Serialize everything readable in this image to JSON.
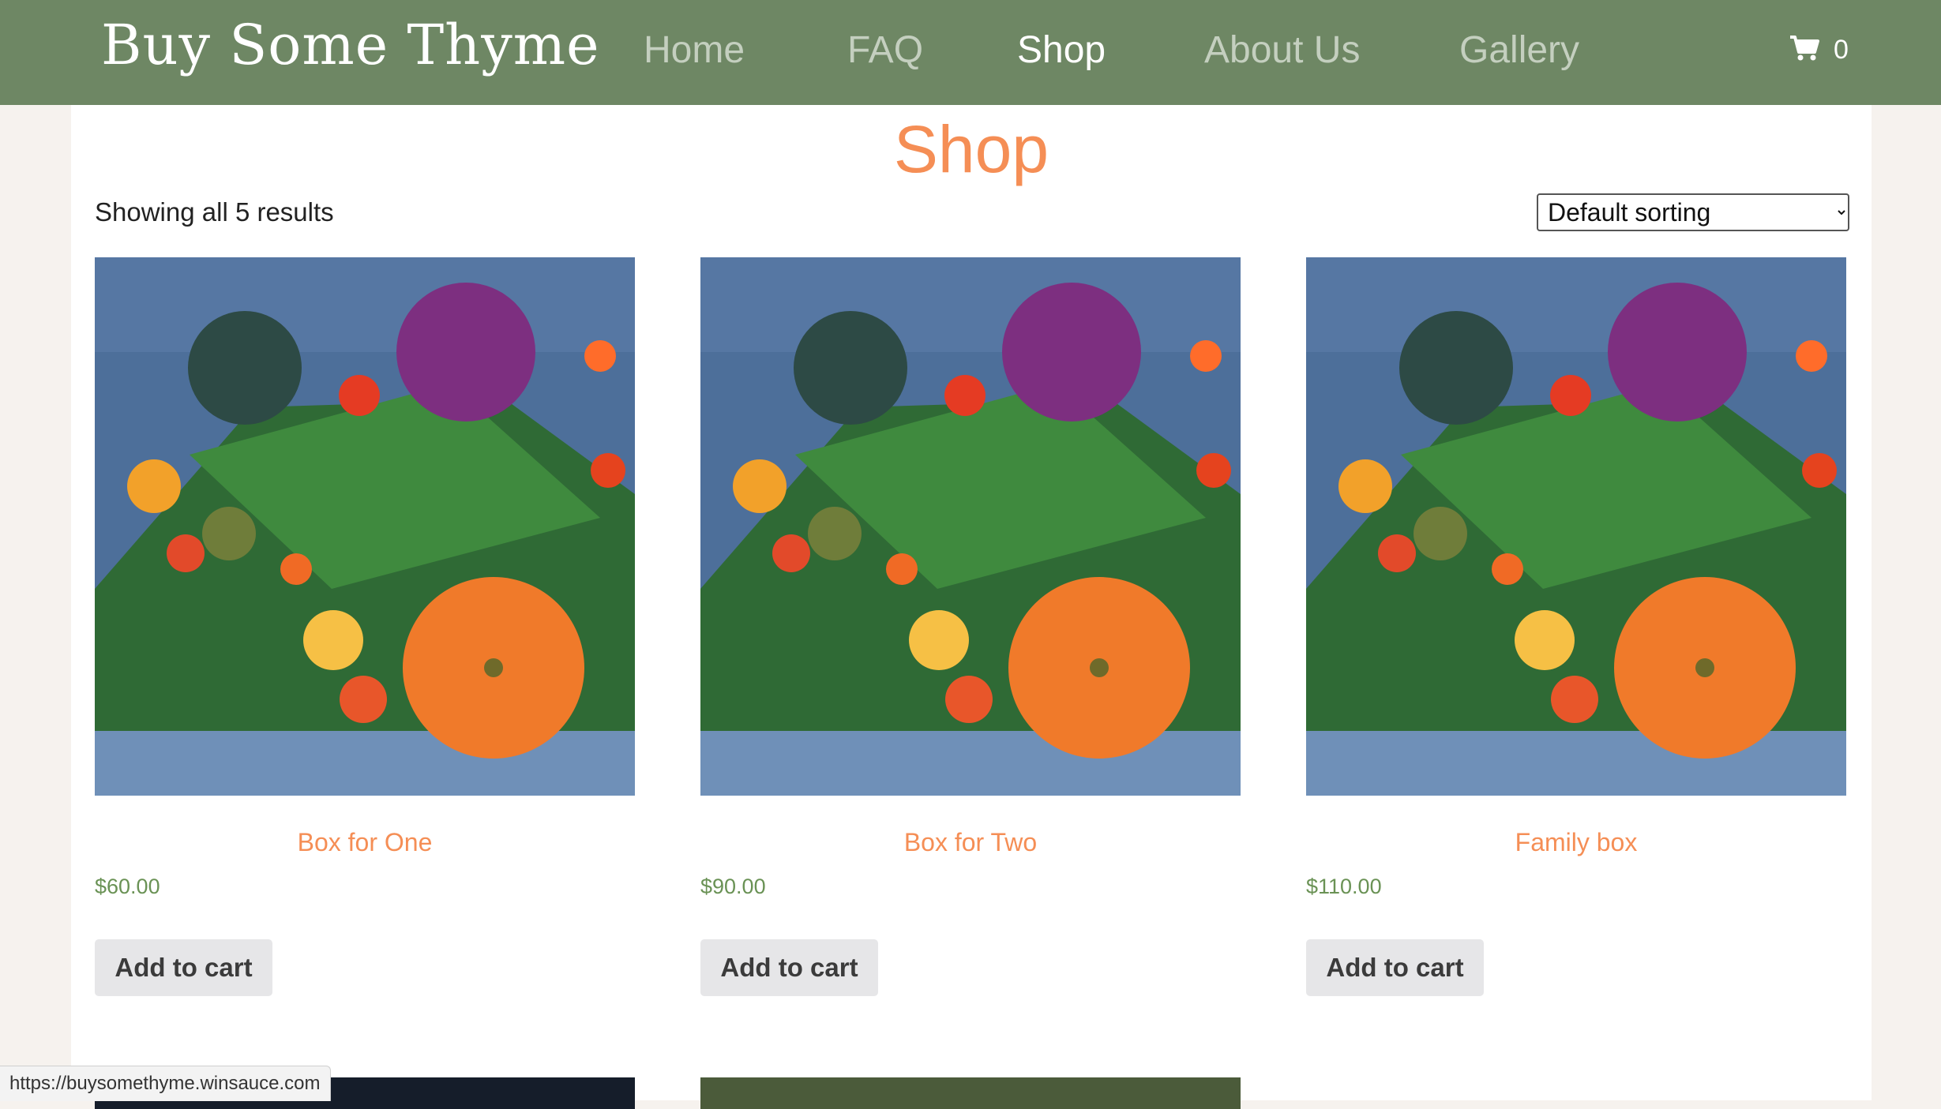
{
  "header": {
    "brand": "Buy Some Thyme",
    "nav": [
      {
        "label": "Home",
        "active": false
      },
      {
        "label": "FAQ",
        "active": false
      },
      {
        "label": "Shop",
        "active": true
      },
      {
        "label": "About Us",
        "active": false
      },
      {
        "label": "Gallery",
        "active": false
      }
    ],
    "cart_count": "0",
    "cart_icon": "shopping-cart-icon"
  },
  "main": {
    "title": "Shop",
    "result_count": "Showing all 5 results",
    "sort": {
      "selected": "Default sorting",
      "options": [
        "Default sorting"
      ]
    },
    "products": [
      {
        "name": "Box for One",
        "price": "$60.00",
        "button": "Add to cart"
      },
      {
        "name": "Box for Two",
        "price": "$90.00",
        "button": "Add to cart"
      },
      {
        "name": "Family box",
        "price": "$110.00",
        "button": "Add to cart"
      }
    ]
  },
  "status_bar": {
    "url": "https://buysomethyme.winsauce.com"
  },
  "colors": {
    "header_bg": "#6e8764",
    "accent_orange": "#f58e55",
    "price_green": "#6a9255",
    "button_bg": "#e6e6e8"
  }
}
